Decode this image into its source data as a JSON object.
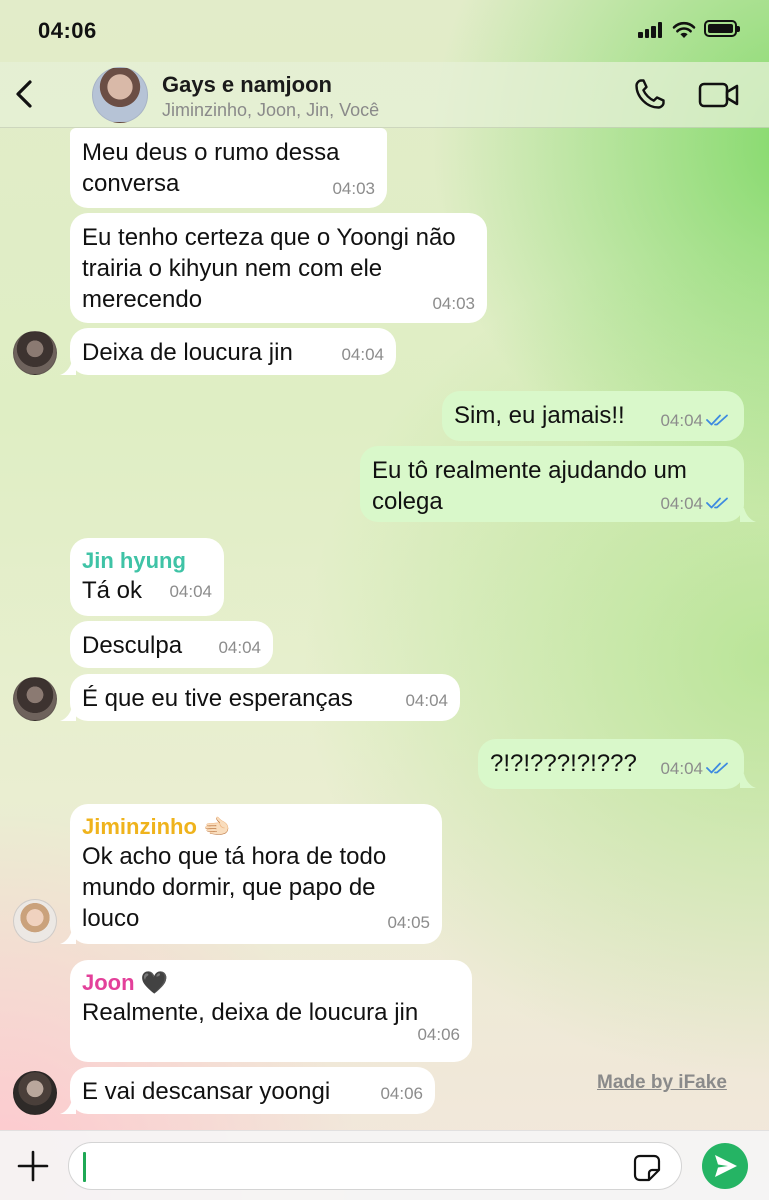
{
  "status_bar": {
    "time": "04:06"
  },
  "header": {
    "title": "Gays e namjoon",
    "subtitle": "Jiminzinho, Joon, Jin, Você"
  },
  "colors": {
    "outgoing_bubble": "#d9f8ca",
    "incoming_bubble": "#ffffff",
    "sender_jin": "#3fc3a6",
    "sender_jimin": "#efb31c",
    "sender_joon": "#e3409a",
    "read_check": "#3d8ae0",
    "send_button": "#25b464"
  },
  "messages": [
    {
      "direction": "in",
      "text": "Meu deus o rumo dessa conversa",
      "time": "04:03"
    },
    {
      "direction": "in",
      "text": "Eu tenho certeza que o Yoongi não trairia o kihyun nem com ele merecendo",
      "time": "04:03"
    },
    {
      "direction": "in",
      "text": "Deixa de loucura jin",
      "time": "04:04",
      "avatar": "jin-avatar"
    },
    {
      "direction": "out",
      "text": "Sim, eu jamais!!",
      "time": "04:04",
      "status": "read"
    },
    {
      "direction": "out",
      "text": "Eu tô realmente ajudando um colega",
      "time": "04:04",
      "status": "read"
    },
    {
      "direction": "in",
      "sender": "Jin hyung",
      "text": "Tá ok",
      "time": "04:04"
    },
    {
      "direction": "in",
      "text": "Desculpa",
      "time": "04:04"
    },
    {
      "direction": "in",
      "text": "É que eu tive esperanças",
      "time": "04:04",
      "avatar": "jin-avatar"
    },
    {
      "direction": "out",
      "text": "?!?!???!?!???",
      "time": "04:04",
      "status": "read"
    },
    {
      "direction": "in",
      "sender": "Jiminzinho 🫲🏻",
      "text": "Ok acho que tá hora de todo mundo dormir, que papo de louco",
      "time": "04:05",
      "avatar": "jimin-avatar"
    },
    {
      "direction": "in",
      "sender": "Joon 🖤",
      "text": "Realmente, deixa de loucura jin",
      "time": "04:06"
    },
    {
      "direction": "in",
      "text": "E vai descansar yoongi",
      "time": "04:06",
      "avatar": "joon-avatar"
    }
  ],
  "watermark": "Made by iFake",
  "input": {
    "value": "",
    "placeholder": ""
  }
}
